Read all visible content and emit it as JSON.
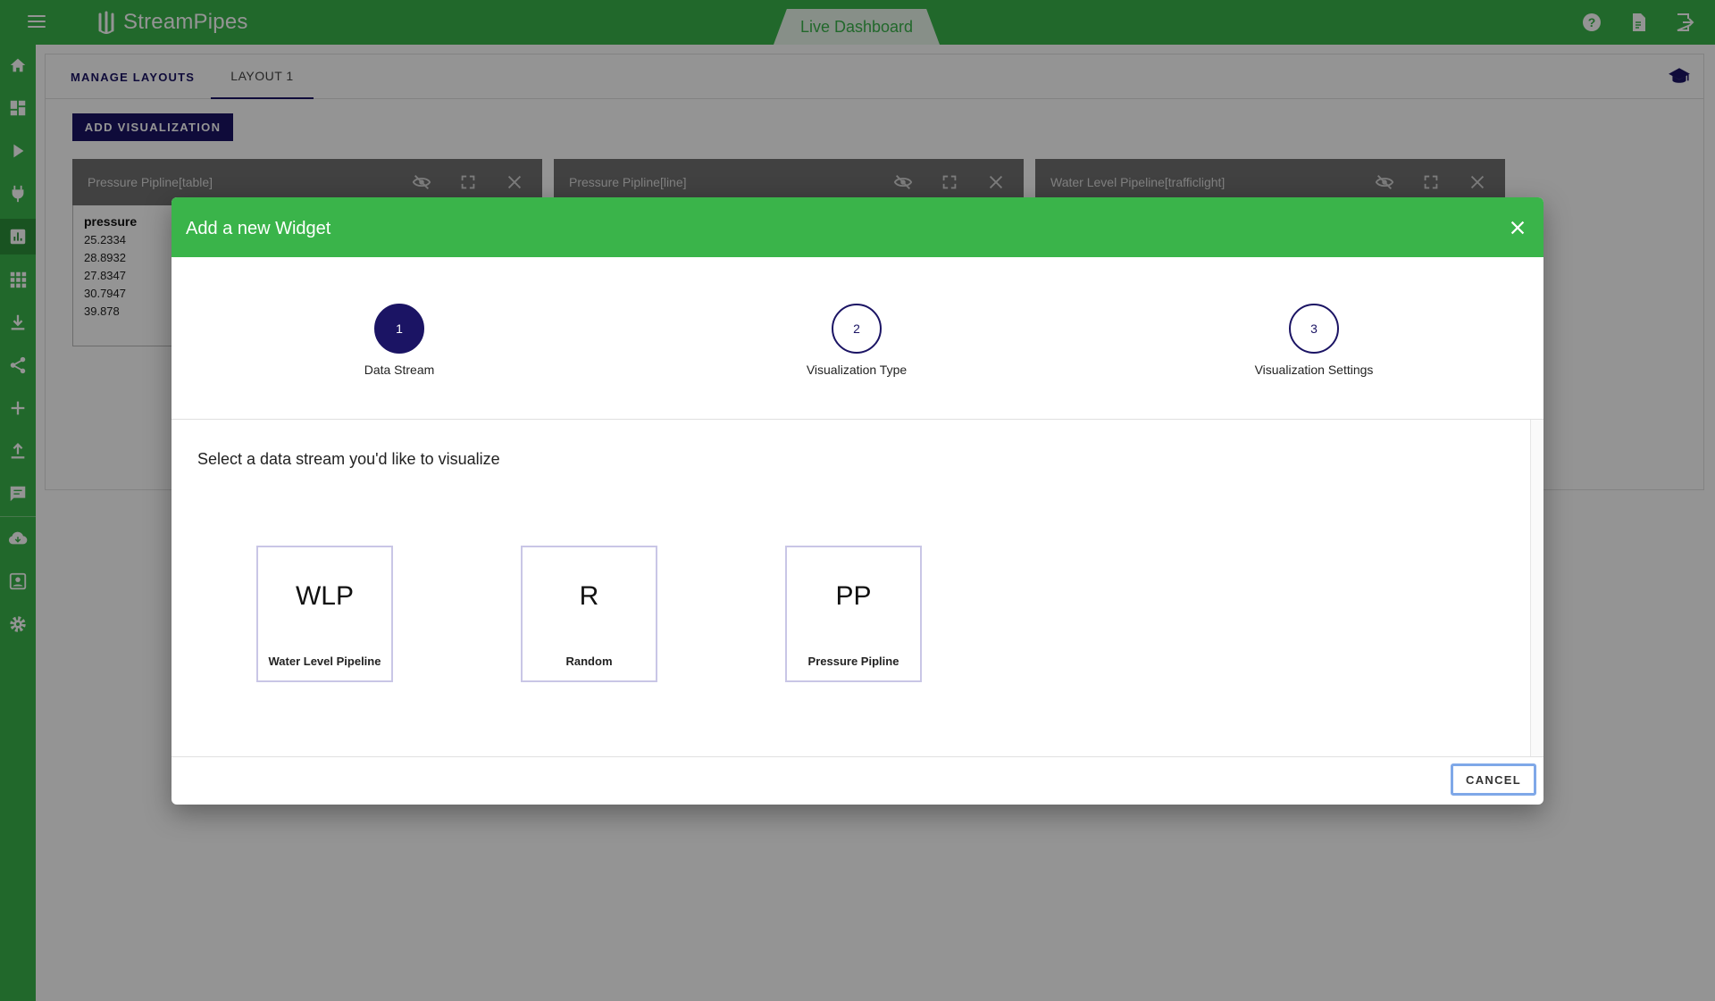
{
  "app": {
    "name": "StreamPipes",
    "current_view": "Live Dashboard"
  },
  "top_icons": [
    "help-icon",
    "description-icon",
    "logout-icon"
  ],
  "sidebar": {
    "items": [
      {
        "icon": "home-icon"
      },
      {
        "icon": "dashboard-icon"
      },
      {
        "icon": "play-icon"
      },
      {
        "icon": "plug-icon"
      },
      {
        "icon": "chart-icon",
        "active": true
      },
      {
        "icon": "apps-icon"
      },
      {
        "icon": "download-icon"
      },
      {
        "icon": "share-icon"
      },
      {
        "icon": "add-icon"
      },
      {
        "icon": "upload-icon"
      },
      {
        "icon": "comment-icon"
      },
      {
        "icon": "cloud-download-icon"
      },
      {
        "icon": "contact-icon"
      },
      {
        "icon": "settings-icon"
      }
    ]
  },
  "tabs": {
    "manage": "MANAGE LAYOUTS",
    "layout": "LAYOUT 1"
  },
  "add_visualization_label": "ADD VISUALIZATION",
  "widgets": [
    {
      "title": "Pressure Pipline[table]",
      "table": {
        "header": "pressure",
        "values": [
          "25.2334",
          "28.8932",
          "27.8347",
          "30.7947",
          "39.878"
        ]
      }
    },
    {
      "title": "Pressure Pipline[line]"
    },
    {
      "title": "Water Level Pipeline[trafficlight]"
    }
  ],
  "dialog": {
    "title": "Add a new Widget",
    "steps": [
      {
        "number": "1",
        "label": "Data Stream",
        "active": true
      },
      {
        "number": "2",
        "label": "Visualization Type",
        "active": false
      },
      {
        "number": "3",
        "label": "Visualization Settings",
        "active": false
      }
    ],
    "instruction": "Select a data stream you'd like to visualize",
    "streams": [
      {
        "abbr": "WLP",
        "name": "Water Level Pipeline"
      },
      {
        "abbr": "R",
        "name": "Random"
      },
      {
        "abbr": "PP",
        "name": "Pressure Pipline"
      }
    ],
    "cancel_label": "CANCEL"
  },
  "colors": {
    "primary_green": "#3ab44a",
    "dark_navy": "#1b1464"
  }
}
